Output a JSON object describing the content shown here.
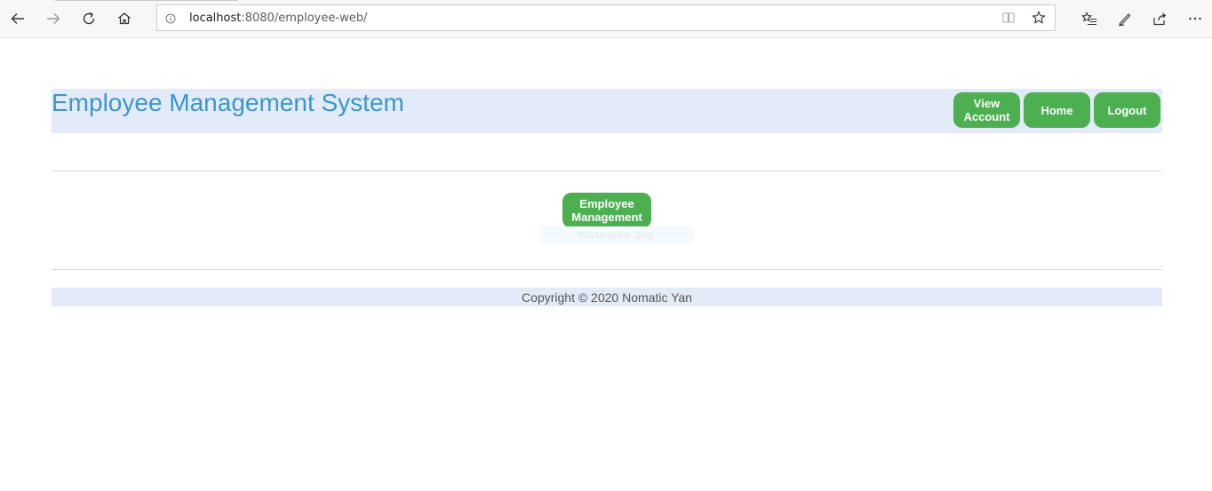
{
  "browser": {
    "url_host": "localhost",
    "url_rest": ":8080/employee-web/",
    "icons": [
      "back-icon",
      "forward-icon",
      "refresh-icon",
      "home-icon",
      "info-icon",
      "reading-view-icon",
      "favorite-star-icon",
      "favorites-list-icon",
      "pen-icon",
      "share-icon",
      "more-icon"
    ]
  },
  "header": {
    "title": "Employee Management System",
    "nav": {
      "view_account_line1": "View",
      "view_account_line2": "Account",
      "home": "Home",
      "logout": "Logout"
    }
  },
  "main": {
    "employee_management_line1": "Employee",
    "employee_management_line2": "Management",
    "tooltip": "Rectangular Snip"
  },
  "footer": {
    "copyright": "Copyright © 2020 Nomatic Yan"
  },
  "colors": {
    "accent_green": "#4caf50",
    "title_blue": "#3a97cf",
    "header_bg": "#e3ebf8"
  }
}
